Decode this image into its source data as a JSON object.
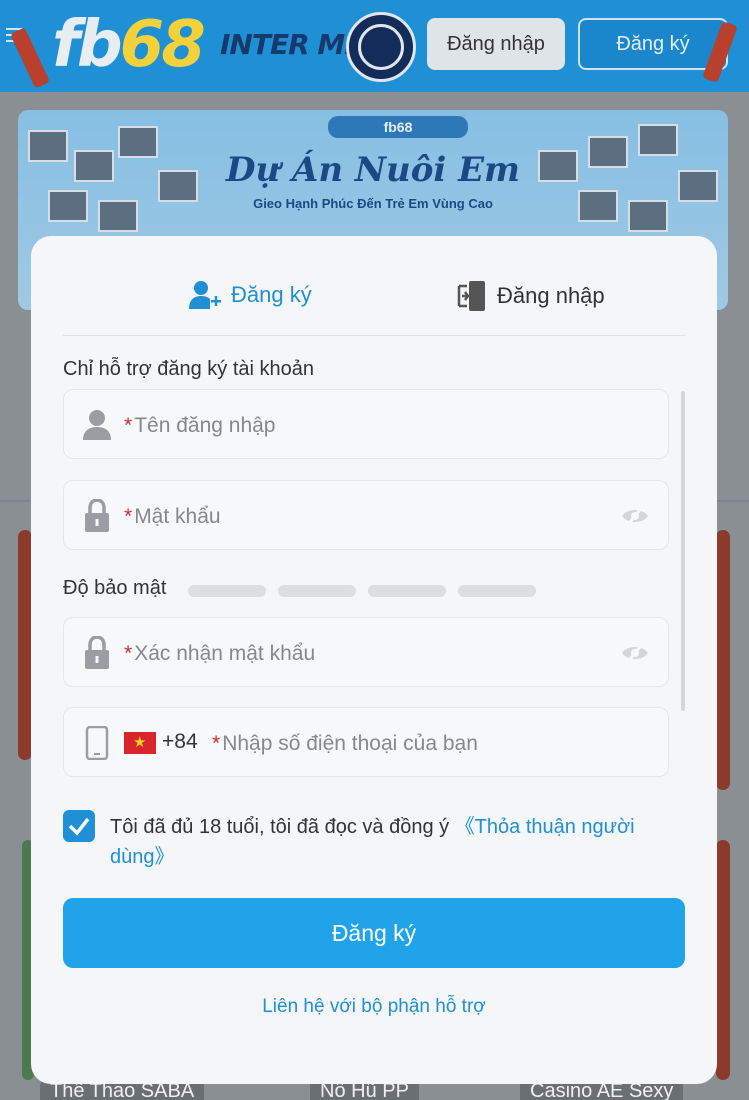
{
  "header": {
    "logo_main": "fb",
    "logo_num": "68",
    "partner": "INTER MIAN",
    "login_label": "Đăng nhập",
    "register_label": "Đăng ký"
  },
  "banner": {
    "top_label": "fb68",
    "title": "Dự Án Nuôi Em",
    "subtitle": "Gieo Hạnh Phúc Đến Trẻ Em Vùng Cao"
  },
  "bottom_tabs": [
    "Thể Thao SABA",
    "Nổ Hũ PP",
    "Casino AE Sexy"
  ],
  "modal": {
    "tabs": {
      "register_label": "Đăng ký",
      "login_label": "Đăng nhập"
    },
    "support_text": "Chỉ hỗ trợ đăng ký tài khoản",
    "fields": {
      "username_placeholder": "Tên đăng nhập",
      "password_placeholder": "Mật khẩu",
      "confirm_password_placeholder": "Xác nhận mật khẩu",
      "phone_placeholder": "Nhập số điện thoại của bạn",
      "phone_code": "+84",
      "required_mark": "*"
    },
    "strength_label": "Độ bảo mật",
    "agreement": {
      "checked": true,
      "text": "Tôi đã đủ 18 tuổi, tôi đã đọc và đồng ý ",
      "link": "《Thỏa thuận người dùng》"
    },
    "submit_label": "Đăng ký",
    "contact_label": "Liên hệ với bộ phận hỗ trợ"
  },
  "colors": {
    "accent": "#1f8fd6",
    "button": "#21a3ea",
    "required": "#d9262a"
  }
}
